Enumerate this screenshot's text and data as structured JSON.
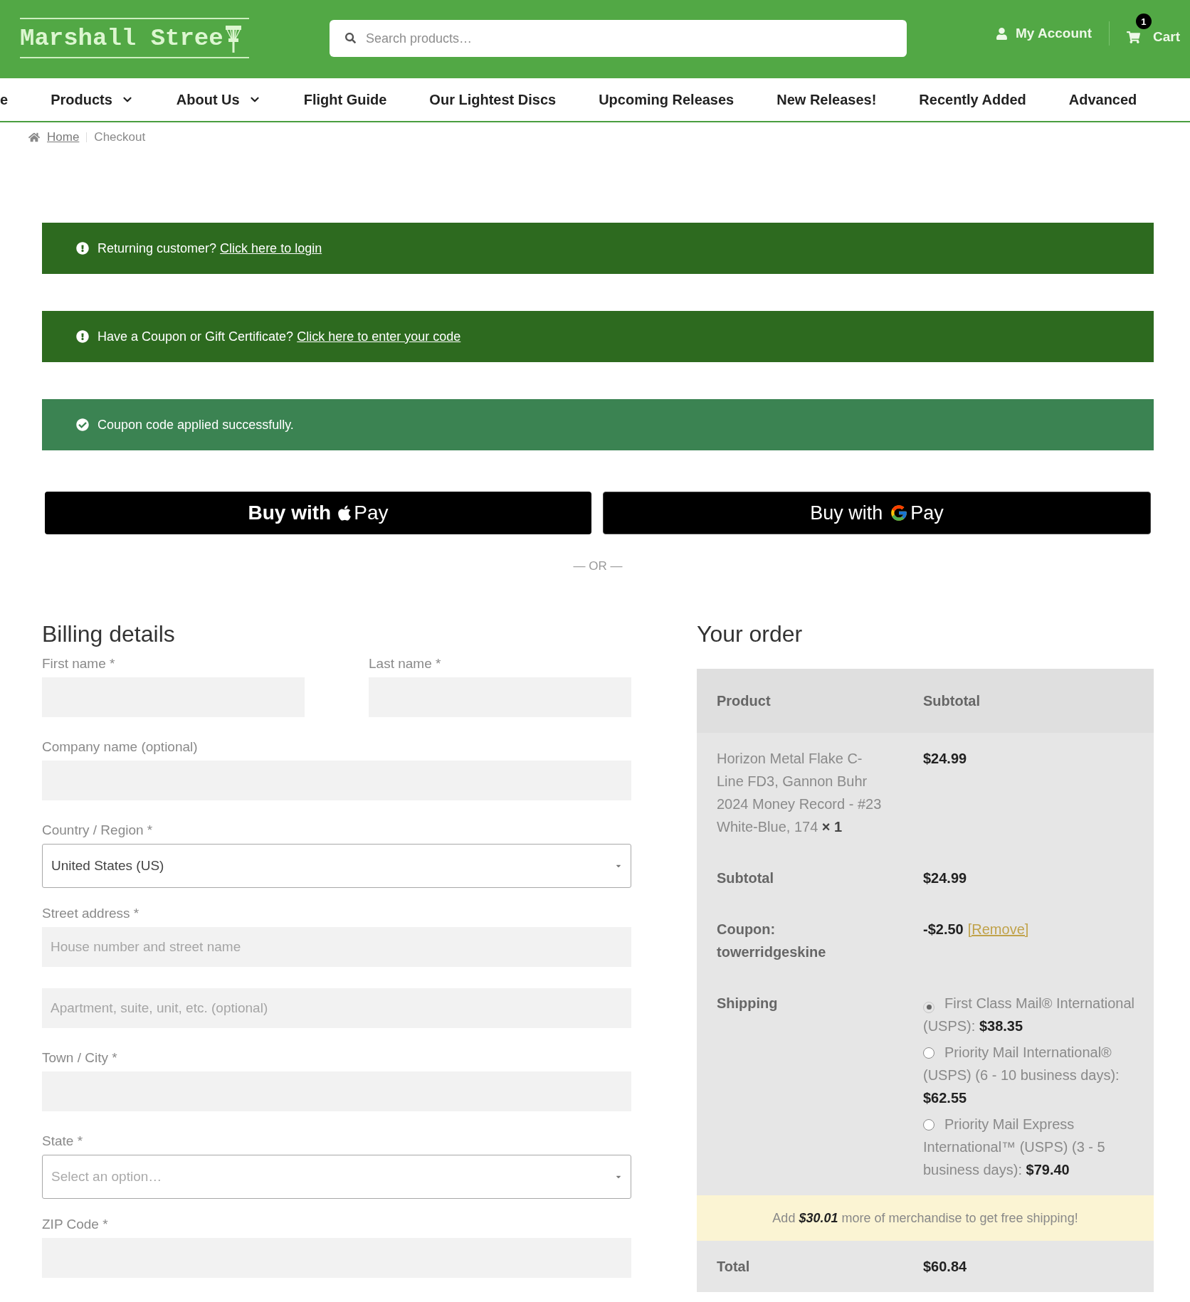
{
  "header": {
    "logo": "Marshall Stree",
    "search": {
      "placeholder": "Search products…"
    },
    "account": "My Account",
    "cart": {
      "label": "Cart",
      "count": "1"
    }
  },
  "nav": [
    {
      "label": "e",
      "has_menu": false
    },
    {
      "label": "Products",
      "has_menu": true
    },
    {
      "label": "About Us",
      "has_menu": true
    },
    {
      "label": "Flight Guide",
      "has_menu": false
    },
    {
      "label": "Our Lightest Discs",
      "has_menu": false
    },
    {
      "label": "Upcoming Releases",
      "has_menu": false
    },
    {
      "label": "New Releases!",
      "has_menu": false
    },
    {
      "label": "Recently Added",
      "has_menu": false
    },
    {
      "label": "Advanced",
      "has_menu": false
    }
  ],
  "breadcrumb": [
    {
      "label": "Home",
      "current": false
    },
    {
      "label": "Checkout",
      "current": true
    }
  ],
  "notices": [
    {
      "kind": "info",
      "text": "Returning customer?",
      "link": "Click here to login"
    },
    {
      "kind": "info",
      "text": "Have a Coupon or Gift Certificate?",
      "link": "Click here to enter your code"
    },
    {
      "kind": "success",
      "text": "Coupon code applied successfully."
    }
  ],
  "express_checkout": {
    "buttons": [
      {
        "kind": "apple",
        "label": "Buy with",
        "brand": "Pay"
      },
      {
        "kind": "google",
        "label": "Buy with",
        "brand": "Pay"
      }
    ],
    "divider": "— OR —"
  },
  "billing": {
    "title": "Billing details",
    "fields": [
      {
        "kind": "pair",
        "fields": [
          {
            "kind": "text",
            "label": "First name *"
          },
          {
            "kind": "text",
            "label": "Last name *"
          }
        ]
      },
      {
        "kind": "text",
        "label": "Company name (optional)"
      },
      {
        "kind": "select",
        "label": "Country / Region *",
        "value": "United States (US)"
      },
      {
        "kind": "text",
        "label": "Street address *",
        "placeholder": "House number and street name"
      },
      {
        "kind": "text",
        "placeholder": "Apartment, suite, unit, etc. (optional)"
      },
      {
        "kind": "text",
        "label": "Town / City *"
      },
      {
        "kind": "select",
        "label": "State *",
        "placeholder": "Select an option…"
      },
      {
        "kind": "text",
        "label": "ZIP Code *"
      }
    ]
  },
  "order": {
    "title": "Your order",
    "columns": [
      "Product",
      "Subtotal"
    ],
    "items": [
      {
        "name": "Horizon Metal Flake C-Line FD3, Gannon Buhr 2024 Money Record - #23 White-Blue, 174",
        "quantity": "× 1",
        "subtotal": "$24.99"
      }
    ],
    "subtotal": {
      "label": "Subtotal",
      "value": "$24.99"
    },
    "coupon": {
      "label": "Coupon:",
      "code": "towerridgeskine",
      "value": "-$2.50",
      "action": "[Remove]"
    },
    "shipping": {
      "label": "Shipping",
      "options": [
        {
          "name": "First Class Mail® International (USPS):",
          "price": "$38.35",
          "selected": true
        },
        {
          "name": "Priority Mail International® (USPS) (6 - 10 business days):",
          "price": "$62.55",
          "selected": false
        },
        {
          "name": "Priority Mail Express International™ (USPS) (3 - 5 business days):",
          "price": "$79.40",
          "selected": false
        }
      ]
    },
    "free_shipping_notice": "Add **$30.01** more of merchandise to get free shipping!",
    "total": {
      "label": "Total",
      "value": "$60.84"
    }
  }
}
